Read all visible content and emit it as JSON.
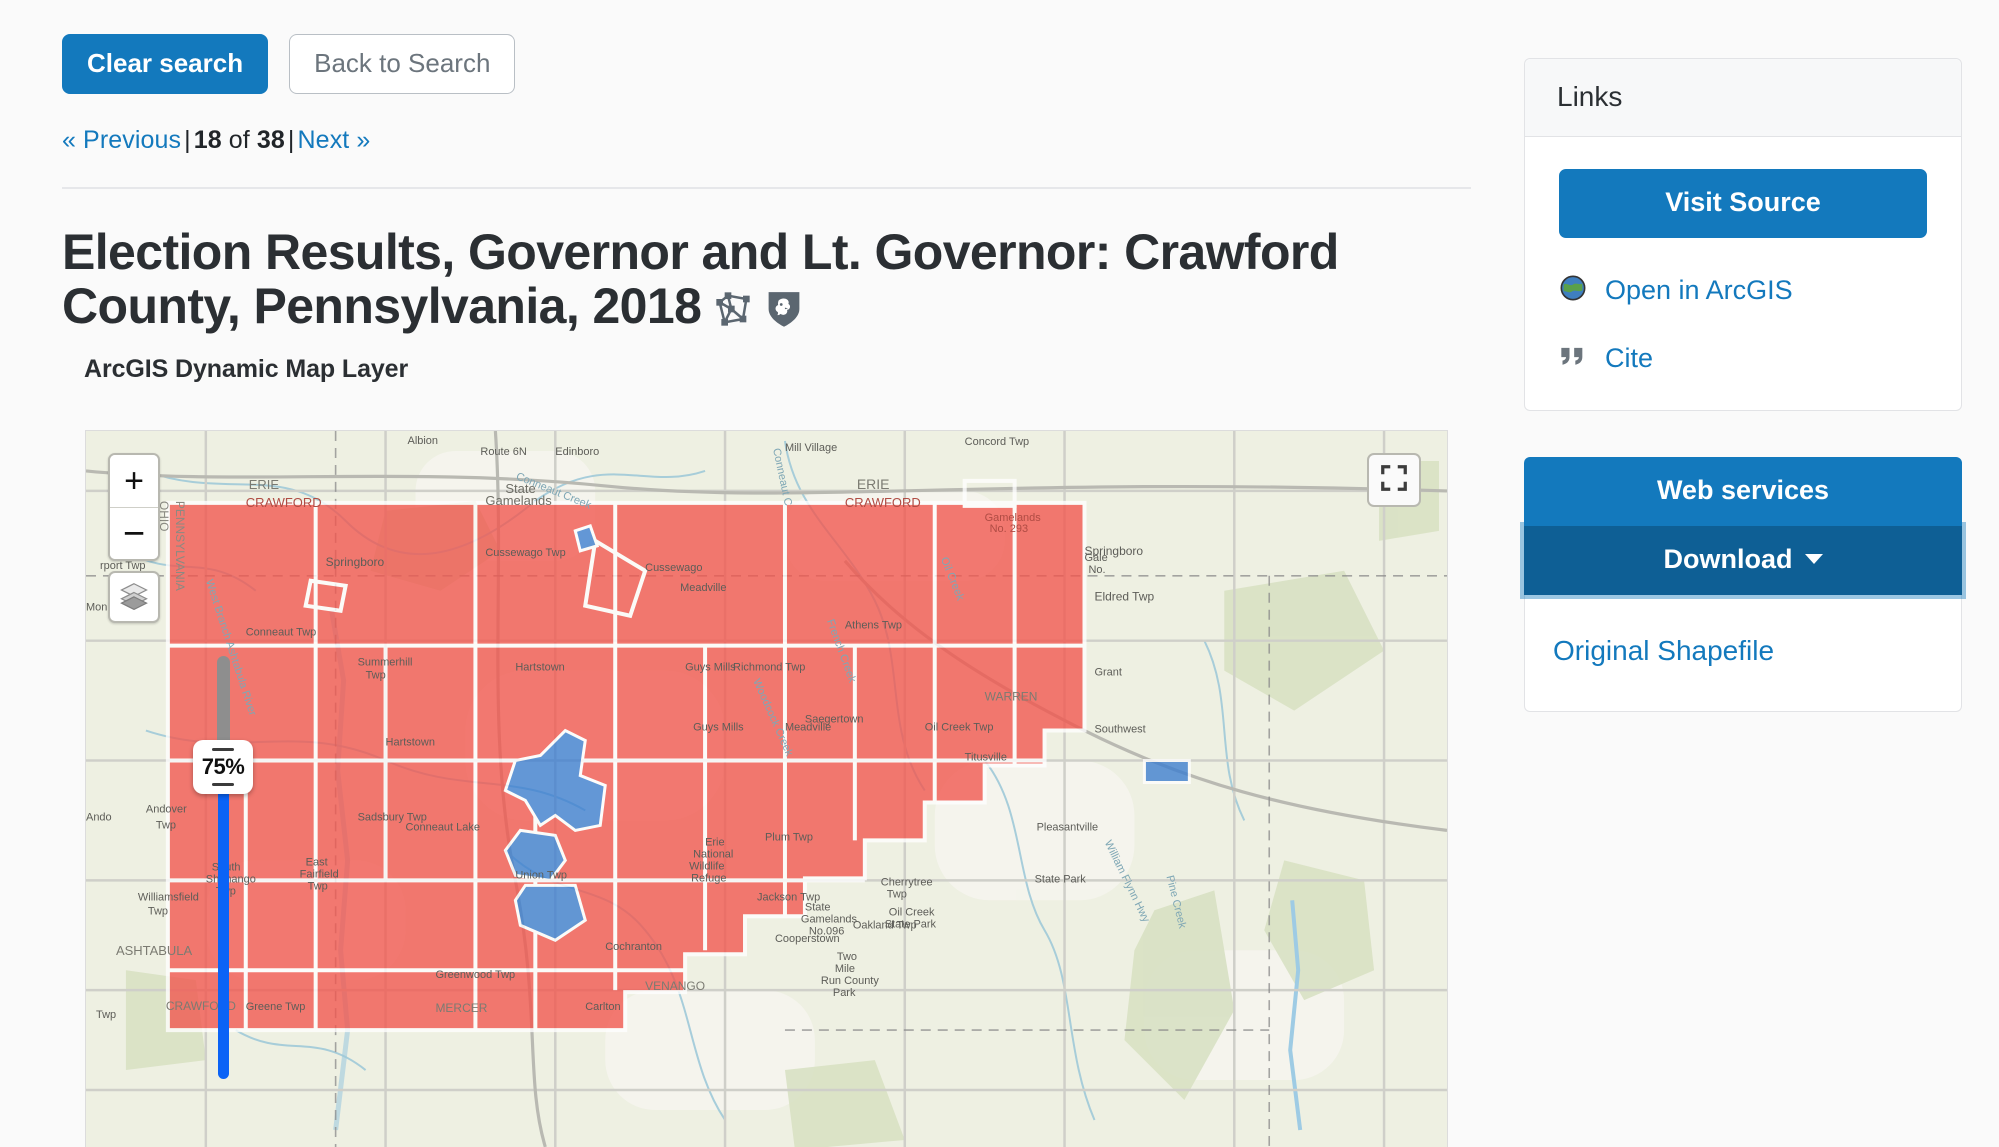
{
  "toolbar": {
    "clear_search_label": "Clear search",
    "back_to_search_label": "Back to Search"
  },
  "pager": {
    "previous_label": "« Previous",
    "current": "18",
    "of_label": "of",
    "total": "38",
    "next_label": "Next »",
    "divider": "|"
  },
  "record": {
    "title": "Election Results, Governor and Lt. Governor: Crawford County, Pennsylvania, 2018",
    "subtitle": "ArcGIS Dynamic Map Layer",
    "icons": [
      "polygon-geometry-icon",
      "penn-state-lion-shield-icon"
    ]
  },
  "map": {
    "zoom_in_label": "+",
    "zoom_out_label": "−",
    "layers_icon": "layers-stack-icon",
    "fullscreen_icon": "fullscreen-expand-icon",
    "opacity_value": "75%",
    "basemap_labels": [
      "ERIE",
      "CRAWFORD",
      "WARREN",
      "VENANGO",
      "MERCER",
      "ASHTABULA",
      "OHIO",
      "PENNSYLVANIA",
      "Edinboro",
      "Mill Village",
      "Concord Twp",
      "Albion",
      "Route 6N",
      "Conneaut Creek",
      "State Gamelands ERIE",
      "Springboro",
      "Conneaut Twp",
      "Summerhill Twp",
      "Cussewago Twp",
      "Meadville",
      "Richmond Twp",
      "Athens Twp",
      "Eldred Twp",
      "Monroe Twp",
      "Andover Twp",
      "Williamsfield Twp",
      "Sadsbury Twp",
      "Conneaut Lake",
      "South Shenango Twp",
      "East Fairfield Twp",
      "Union Twp",
      "Greenwood Twp",
      "Cochranton",
      "Guys Mills",
      "Erie National Wildlife Refuge",
      "Jackson Twp",
      "Plum Twp",
      "Cherrytree Twp",
      "Oil Creek State Park",
      "Oakland Twp",
      "Cooperstown",
      "Two Mile Run County Park",
      "Pleasantville",
      "Titusville",
      "Oil Creek Twp",
      "Pine Creek",
      "Carlton",
      "Greene Twp",
      "Hartstown",
      "West Branch",
      "Ashtabula River",
      "French Creek",
      "Woodcock Creek",
      "Shenango River"
    ],
    "legend": {
      "republican_color": "#f2564e",
      "democrat_color": "#3b7dd0"
    }
  },
  "sidebar": {
    "links_card": {
      "header": "Links",
      "visit_source_label": "Visit Source",
      "items": [
        {
          "icon": "globe-icon",
          "label": "Open in ArcGIS"
        },
        {
          "icon": "quote-icon",
          "label": "Cite"
        }
      ]
    },
    "services_card": {
      "web_services_label": "Web services",
      "download_label": "Download",
      "dropdown_items": [
        {
          "label": "Original Shapefile"
        }
      ]
    }
  },
  "colors": {
    "accent_blue": "#1379bd",
    "download_active_blue": "#0e5f95",
    "link_blue": "#1379bd",
    "page_bg": "#fafafa"
  }
}
